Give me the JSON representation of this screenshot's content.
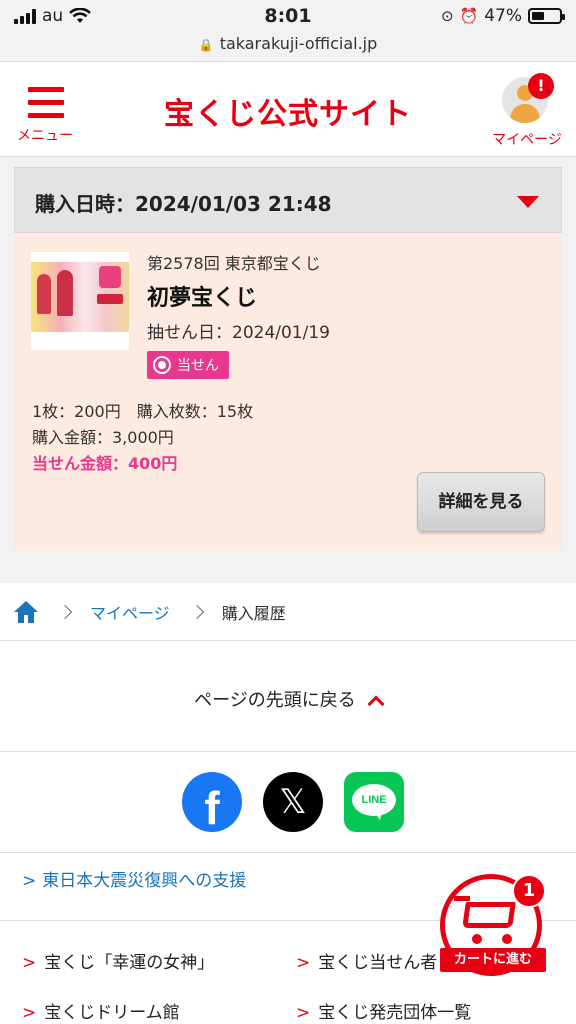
{
  "status_bar": {
    "carrier": "au",
    "time": "8:01",
    "battery": "47%"
  },
  "browser": {
    "url": "takarakuji-official.jp"
  },
  "header": {
    "menu_label": "メニュー",
    "site_title": "宝くじ公式サイト",
    "mypage_label": "マイページ",
    "alert_badge": "!"
  },
  "purchase": {
    "datetime_label": "購入日時：",
    "datetime_value": "2024/01/03 21:48",
    "round": "第2578回 東京都宝くじ",
    "name": "初夢宝くじ",
    "draw_date": "抽せん日：2024/01/19",
    "status_badge": "当せん",
    "price_line": "1枚：200円　購入枚数：15枚",
    "amount_line": "購入金額：3,000円",
    "win_line": "当せん金額：400円",
    "detail_button": "詳細を見る"
  },
  "breadcrumb": {
    "items": [
      "マイページ",
      "購入履歴"
    ]
  },
  "back_to_top": "ページの先頭に戻る",
  "social": {
    "facebook": "f",
    "x": "𝕏",
    "line": "LINE"
  },
  "footer": {
    "support_link": "東日本大震災復興への支援",
    "links": [
      "宝くじ「幸運の女神」",
      "宝くじ当せん者",
      "宝くじドリーム館",
      "宝くじ発売団体一覧"
    ]
  },
  "cart": {
    "count": "1",
    "label": "カートに進む"
  },
  "colors": {
    "brand": "#e60012",
    "link": "#1b74b9",
    "win": "#e8388e",
    "card_bg": "#fdebe1"
  }
}
